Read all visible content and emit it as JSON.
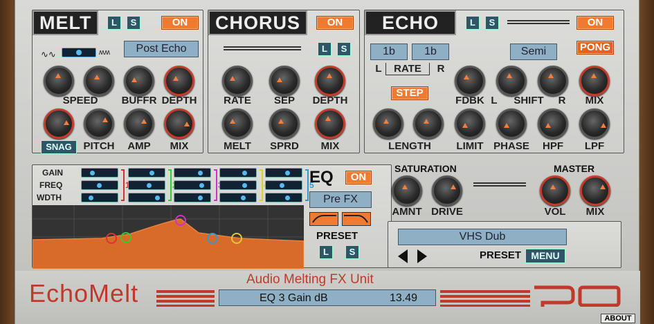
{
  "melt": {
    "title": "MELT",
    "l": "L",
    "s": "S",
    "on": "ON",
    "route": "Post Echo",
    "knobs": [
      "SPEED",
      "BUFFR",
      "DEPTH",
      "PITCH",
      "AMP",
      "MIX"
    ],
    "snag": "SNAG"
  },
  "chorus": {
    "title": "CHORUS",
    "on": "ON",
    "l": "L",
    "s": "S",
    "knobs": [
      "RATE",
      "SEP",
      "DEPTH",
      "MELT",
      "SPRD",
      "MIX"
    ]
  },
  "echo": {
    "title": "ECHO",
    "l": "L",
    "s": "S",
    "on": "ON",
    "pong": "PONG",
    "rate_l": "1b",
    "rate_r": "1b",
    "rate_label": "RATE",
    "l_label": "L",
    "r_label": "R",
    "semi": "Semi",
    "step": "STEP",
    "knobs": [
      "FDBK",
      "L",
      "SHIFT",
      "R",
      "MIX",
      "LENGTH",
      "LIMIT",
      "PHASE",
      "HPF",
      "LPF"
    ]
  },
  "eq": {
    "rows": [
      "GAIN",
      "FREQ",
      "WDTH"
    ],
    "bands": [
      "1",
      "2",
      "3",
      "4",
      "5"
    ],
    "title": "EQ",
    "on": "ON",
    "route": "Pre FX",
    "preset": "PRESET",
    "l": "L",
    "s": "S"
  },
  "saturation": {
    "title": "SATURATION",
    "amnt": "AMNT",
    "drive": "DRIVE"
  },
  "master": {
    "title": "MASTER",
    "vol": "VOL",
    "mix": "MIX"
  },
  "preset": {
    "name": "VHS Dub",
    "label": "PRESET",
    "menu": "MENU"
  },
  "footer": {
    "brand": "EchoMelt",
    "tagline": "Audio Melting FX Unit",
    "param": "EQ 3 Gain dB",
    "value": "13.49",
    "about": "ABOUT"
  },
  "colors": {
    "orange": "#f07a30",
    "red": "#c0392b",
    "lcd": "#8fb0c4"
  }
}
